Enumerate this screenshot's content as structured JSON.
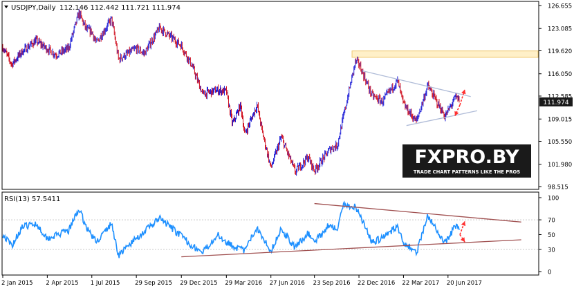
{
  "header": {
    "symbol_label": "USDJPY,Daily",
    "ohlc": "112.146 112.442 111.721 111.974"
  },
  "rsi_header": "RSI(13) 57.5411",
  "watermark": {
    "brand": "FXPRO.BY",
    "tagline": "TRADE CHART PATTERNS LIKE THE PROS",
    "brand_color": "#ffffff",
    "box_color": "#1a1a1a"
  },
  "colors": {
    "bull_candle": "#1a1ad6",
    "bear_candle": "#d01020",
    "rsi_line": "#1e90ff",
    "price_trendline": "#b0bcd8",
    "rsi_trendline": "#a05050",
    "arrow": "#ff3030",
    "resistance_zone": "#fff0c8",
    "resistance_border": "#f0c870",
    "current_price_box": "#1a1a1a"
  },
  "chart_data": [
    {
      "type": "candlestick",
      "symbol": "USDJPY",
      "timeframe": "Daily",
      "ylim": [
        98.515,
        126.655
      ],
      "y_tick_labels": [
        "126.655",
        "123.085",
        "119.620",
        "116.050",
        "112.585",
        "109.015",
        "105.550",
        "101.980",
        "98.515"
      ],
      "current_price": "111.974",
      "x_tick_labels": [
        "2 Jan 2015",
        "2 Apr 2015",
        "1 Jul 2015",
        "29 Sep 2015",
        "29 Dec 2015",
        "29 Mar 2016",
        "27 Jun 2016",
        "23 Sep 2016",
        "22 Dec 2016",
        "22 Mar 2017",
        "20 Jun 2017"
      ],
      "x_tick_dates": [
        "2015-01-02",
        "2015-04-02",
        "2015-07-01",
        "2015-09-29",
        "2015-12-29",
        "2016-03-29",
        "2016-06-27",
        "2016-09-23",
        "2016-12-22",
        "2017-03-22",
        "2017-06-20"
      ],
      "close_path": [
        {
          "date": "2015-01-02",
          "value": 120.2
        },
        {
          "date": "2015-01-20",
          "value": 117.5
        },
        {
          "date": "2015-02-10",
          "value": 119.5
        },
        {
          "date": "2015-03-10",
          "value": 121.2
        },
        {
          "date": "2015-04-02",
          "value": 119.9
        },
        {
          "date": "2015-04-20",
          "value": 119.0
        },
        {
          "date": "2015-05-15",
          "value": 120.0
        },
        {
          "date": "2015-06-05",
          "value": 125.5
        },
        {
          "date": "2015-06-20",
          "value": 122.9
        },
        {
          "date": "2015-07-01",
          "value": 122.6
        },
        {
          "date": "2015-07-10",
          "value": 120.8
        },
        {
          "date": "2015-08-10",
          "value": 124.6
        },
        {
          "date": "2015-08-24",
          "value": 118.3
        },
        {
          "date": "2015-09-29",
          "value": 120.0
        },
        {
          "date": "2015-10-15",
          "value": 119.2
        },
        {
          "date": "2015-11-15",
          "value": 123.2
        },
        {
          "date": "2015-12-29",
          "value": 120.4
        },
        {
          "date": "2016-01-20",
          "value": 117.2
        },
        {
          "date": "2016-02-10",
          "value": 112.9
        },
        {
          "date": "2016-03-10",
          "value": 113.5
        },
        {
          "date": "2016-03-29",
          "value": 113.3
        },
        {
          "date": "2016-04-10",
          "value": 108.2
        },
        {
          "date": "2016-04-27",
          "value": 111.2
        },
        {
          "date": "2016-05-05",
          "value": 106.6
        },
        {
          "date": "2016-05-30",
          "value": 111.2
        },
        {
          "date": "2016-06-10",
          "value": 106.9
        },
        {
          "date": "2016-06-27",
          "value": 101.4
        },
        {
          "date": "2016-07-18",
          "value": 106.2
        },
        {
          "date": "2016-08-15",
          "value": 100.8
        },
        {
          "date": "2016-09-10",
          "value": 103.1
        },
        {
          "date": "2016-09-23",
          "value": 101.0
        },
        {
          "date": "2016-10-25",
          "value": 104.4
        },
        {
          "date": "2016-11-08",
          "value": 104.9
        },
        {
          "date": "2016-12-15",
          "value": 118.0
        },
        {
          "date": "2016-12-22",
          "value": 117.6
        },
        {
          "date": "2017-01-17",
          "value": 112.7
        },
        {
          "date": "2017-02-07",
          "value": 111.7
        },
        {
          "date": "2017-03-10",
          "value": 115.0
        },
        {
          "date": "2017-03-22",
          "value": 111.3
        },
        {
          "date": "2017-04-17",
          "value": 108.6
        },
        {
          "date": "2017-05-10",
          "value": 114.2
        },
        {
          "date": "2017-06-14",
          "value": 109.4
        },
        {
          "date": "2017-07-05",
          "value": 112.4
        },
        {
          "date": "2017-07-14",
          "value": 111.974
        }
      ],
      "annotations": {
        "resistance_zone": {
          "from": "2016-12-08",
          "to": "2017-12-31",
          "y_low": 118.6,
          "y_high": 119.6
        },
        "upper_trendline": {
          "start": {
            "date": "2016-12-29",
            "value": 116.5
          },
          "end": {
            "date": "2017-08-05",
            "value": 112.5
          }
        },
        "lower_trendline": {
          "start": {
            "date": "2017-03-28",
            "value": 108.0
          },
          "end": {
            "date": "2017-08-18",
            "value": 110.3
          }
        },
        "arrows": [
          {
            "from": {
              "date": "2017-07-14",
              "value": 111.2
            },
            "to": {
              "date": "2017-07-24",
              "value": 113.6
            }
          },
          {
            "from": {
              "date": "2017-07-14",
              "value": 111.2
            },
            "to": {
              "date": "2017-07-04",
              "value": 109.5
            }
          }
        ]
      }
    },
    {
      "type": "line",
      "indicator": "RSI(13)",
      "ylim": [
        0,
        100
      ],
      "y_tick_labels": [
        "100",
        "70",
        "50",
        "30",
        "0"
      ],
      "series": [
        {
          "name": "RSI(13)",
          "points": [
            {
              "date": "2015-01-02",
              "value": 50
            },
            {
              "date": "2015-01-20",
              "value": 35
            },
            {
              "date": "2015-02-10",
              "value": 60
            },
            {
              "date": "2015-03-10",
              "value": 65
            },
            {
              "date": "2015-04-02",
              "value": 45
            },
            {
              "date": "2015-05-15",
              "value": 55
            },
            {
              "date": "2015-06-05",
              "value": 85
            },
            {
              "date": "2015-06-20",
              "value": 60
            },
            {
              "date": "2015-07-10",
              "value": 40
            },
            {
              "date": "2015-08-10",
              "value": 65
            },
            {
              "date": "2015-08-24",
              "value": 22
            },
            {
              "date": "2015-09-29",
              "value": 45
            },
            {
              "date": "2015-11-15",
              "value": 72
            },
            {
              "date": "2015-12-29",
              "value": 48
            },
            {
              "date": "2016-01-20",
              "value": 35
            },
            {
              "date": "2016-02-10",
              "value": 25
            },
            {
              "date": "2016-03-10",
              "value": 50
            },
            {
              "date": "2016-04-10",
              "value": 35
            },
            {
              "date": "2016-05-05",
              "value": 28
            },
            {
              "date": "2016-05-30",
              "value": 60
            },
            {
              "date": "2016-06-27",
              "value": 28
            },
            {
              "date": "2016-07-18",
              "value": 58
            },
            {
              "date": "2016-08-15",
              "value": 32
            },
            {
              "date": "2016-09-10",
              "value": 52
            },
            {
              "date": "2016-09-23",
              "value": 40
            },
            {
              "date": "2016-10-25",
              "value": 65
            },
            {
              "date": "2016-11-08",
              "value": 55
            },
            {
              "date": "2016-11-20",
              "value": 90
            },
            {
              "date": "2016-12-15",
              "value": 88
            },
            {
              "date": "2016-12-22",
              "value": 80
            },
            {
              "date": "2017-01-17",
              "value": 40
            },
            {
              "date": "2017-02-07",
              "value": 45
            },
            {
              "date": "2017-03-10",
              "value": 62
            },
            {
              "date": "2017-03-22",
              "value": 40
            },
            {
              "date": "2017-04-17",
              "value": 25
            },
            {
              "date": "2017-05-10",
              "value": 75
            },
            {
              "date": "2017-06-14",
              "value": 38
            },
            {
              "date": "2017-07-05",
              "value": 62
            },
            {
              "date": "2017-07-14",
              "value": 57.5
            }
          ]
        }
      ],
      "annotations": {
        "upper_trendline": {
          "start": {
            "date": "2016-09-23",
            "value": 92
          },
          "end": {
            "date": "2017-11-15",
            "value": 67
          }
        },
        "lower_trendline": {
          "start": {
            "date": "2015-12-29",
            "value": 20
          },
          "end": {
            "date": "2017-11-15",
            "value": 43
          }
        },
        "arrows": [
          {
            "from": {
              "date": "2017-07-14",
              "value": 50
            },
            "to": {
              "date": "2017-07-24",
              "value": 68
            }
          },
          {
            "from": {
              "date": "2017-07-14",
              "value": 50
            },
            "to": {
              "date": "2017-07-24",
              "value": 40
            }
          }
        ]
      }
    }
  ]
}
